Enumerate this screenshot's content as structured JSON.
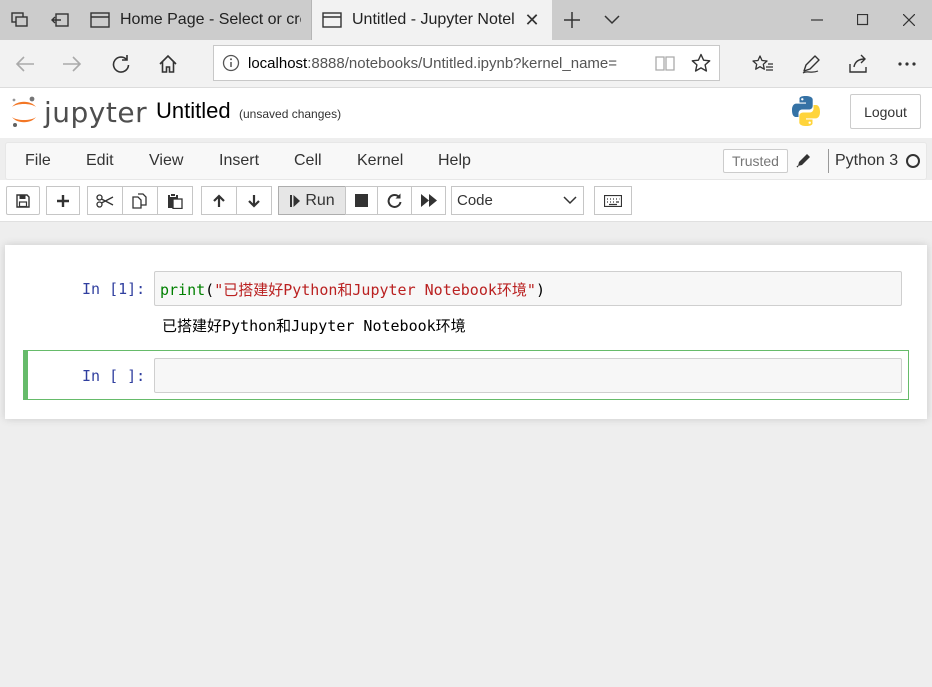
{
  "browser": {
    "tabs": [
      {
        "title": "Home Page - Select or creat",
        "active": false
      },
      {
        "title": "Untitled - Jupyter Notel",
        "active": true
      }
    ],
    "url_host": "localhost",
    "url_rest": ":8888/notebooks/Untitled.ipynb?kernel_name="
  },
  "jupyter": {
    "logo_text": "jupyter",
    "notebook_title": "Untitled",
    "save_status": "(unsaved changes)",
    "logout_label": "Logout"
  },
  "menubar": {
    "items": [
      "File",
      "Edit",
      "View",
      "Insert",
      "Cell",
      "Kernel",
      "Help"
    ],
    "trusted_label": "Trusted",
    "kernel_name": "Python 3"
  },
  "toolbar": {
    "run_label": "Run",
    "cell_type": "Code"
  },
  "cells": [
    {
      "prompt": "In [1]:",
      "code_func": "print",
      "code_open": "(",
      "code_string": "\"已搭建好Python和Jupyter Notebook环境\"",
      "code_close": ")",
      "output": "已搭建好Python和Jupyter Notebook环境"
    },
    {
      "prompt": "In [ ]:",
      "code": ""
    }
  ],
  "colors": {
    "prompt_in": "#303f9f",
    "selected_border": "#66bb6a",
    "builtin": "#008000",
    "string": "#ba2121"
  }
}
